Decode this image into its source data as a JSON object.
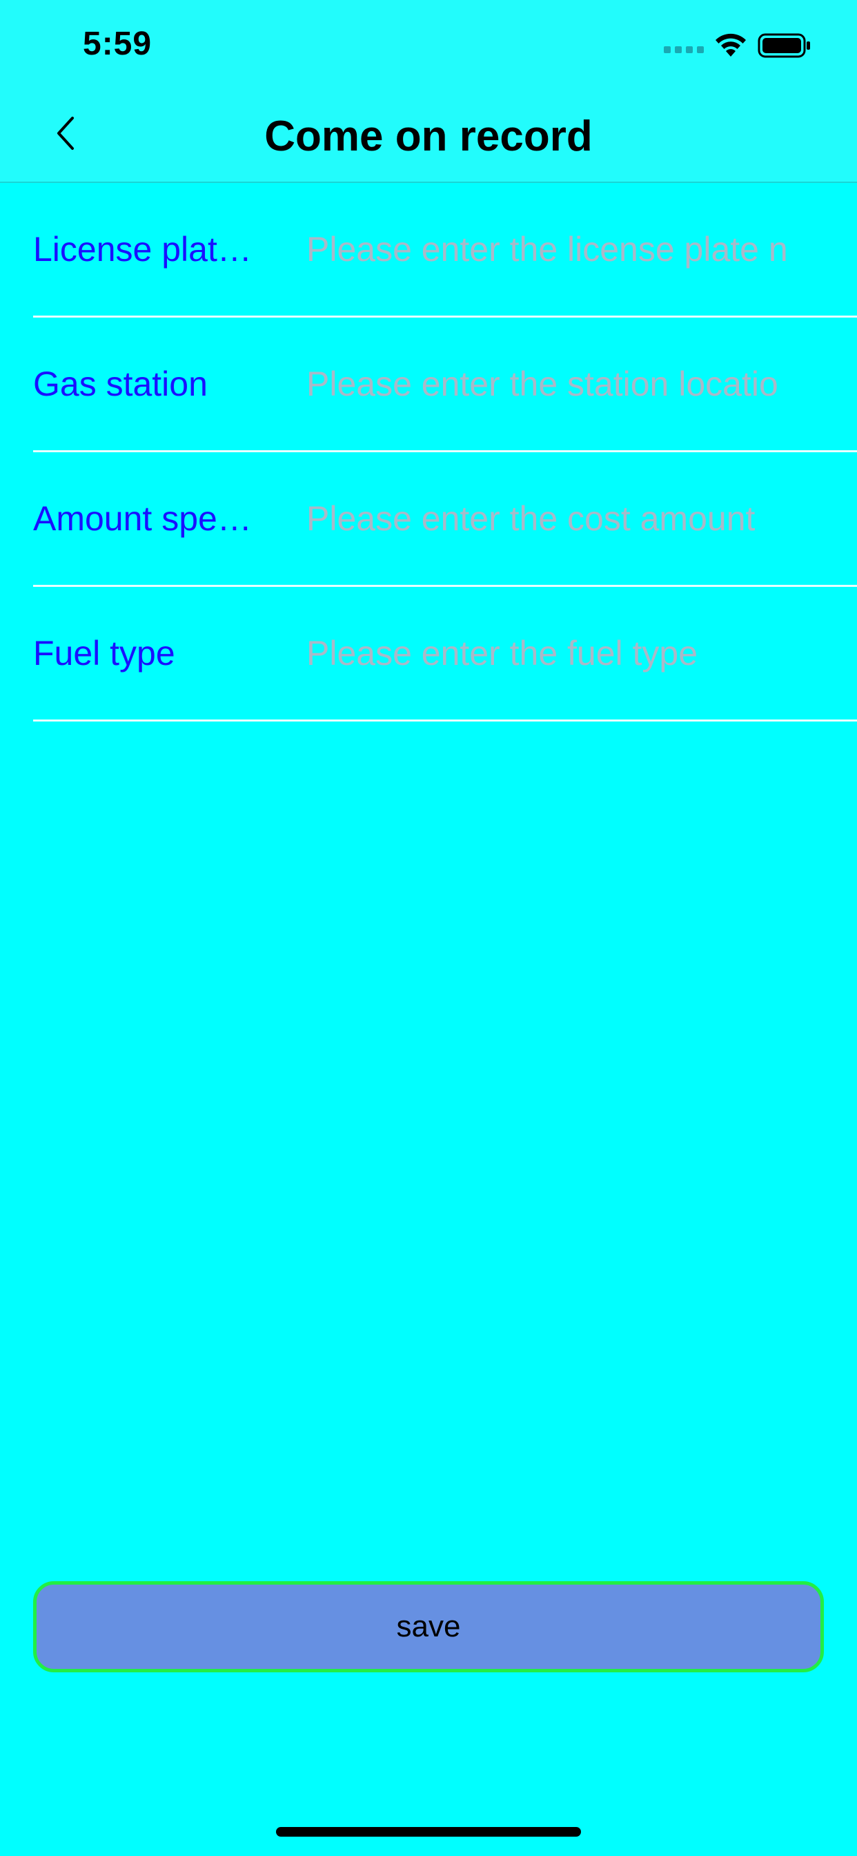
{
  "status_bar": {
    "time": "5:59"
  },
  "nav": {
    "title": "Come on record",
    "back_icon": "chevron-left-icon"
  },
  "form": {
    "rows": [
      {
        "label": "License plat…",
        "placeholder": "Please enter the license plate n",
        "value": ""
      },
      {
        "label": "Gas station",
        "placeholder": "Please enter the station locatio",
        "value": ""
      },
      {
        "label": "Amount spe…",
        "placeholder": "Please enter the cost amount",
        "value": ""
      },
      {
        "label": "Fuel type",
        "placeholder": "Please enter the fuel type",
        "value": ""
      }
    ]
  },
  "actions": {
    "save_label": "save"
  },
  "colors": {
    "background": "#00ffff",
    "header_background": "#22fcfc",
    "label": "#1a10ff",
    "placeholder": "#aab8c8",
    "save_fill": "#6690e2",
    "save_border": "#22ee44"
  }
}
